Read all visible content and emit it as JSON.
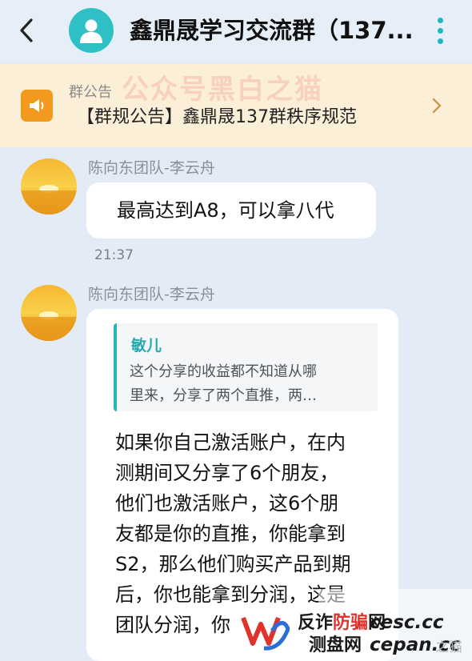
{
  "header": {
    "title": "鑫鼎晟学习交流群（137...",
    "back_icon": "chevron-left-icon",
    "avatar_icon": "group-avatar-icon",
    "more_icon": "more-vertical-icon",
    "accent_color": "#20b6bd"
  },
  "announcement": {
    "label": "群公告",
    "text": "【群规公告】鑫鼎晟137群秩序规范",
    "icon": "megaphone-icon",
    "icon_color": "#f29a1e"
  },
  "messages": [
    {
      "sender": "陈向东团队-李云舟",
      "text": "最高达到A8，可以拿八代",
      "time": "21:37"
    },
    {
      "sender": "陈向东团队-李云舟",
      "quote": {
        "author": "敏儿",
        "lines": [
          "这个分享的收益都不知道从哪",
          "里来，分享了两个直推，两…"
        ]
      },
      "lines": [
        "如果你自己激活账户，在内",
        "测期间又分享了6个朋友，",
        "他们也激活账户，这6个朋",
        "友都是你的直推，你能拿到",
        "S2，那么他们购买产品到期",
        "后，你也能拿到分润，这是",
        "团队分润，你"
      ]
    }
  ],
  "watermarks": {
    "wechat_account": "公众号黑白之猫",
    "line1": "反诈",
    "line1_red": "防骗",
    "line1_tail": "网",
    "domain1": "cesc.cc",
    "line2": "测盘网",
    "domain2": "cepan.cc",
    "tail": "之猫"
  }
}
